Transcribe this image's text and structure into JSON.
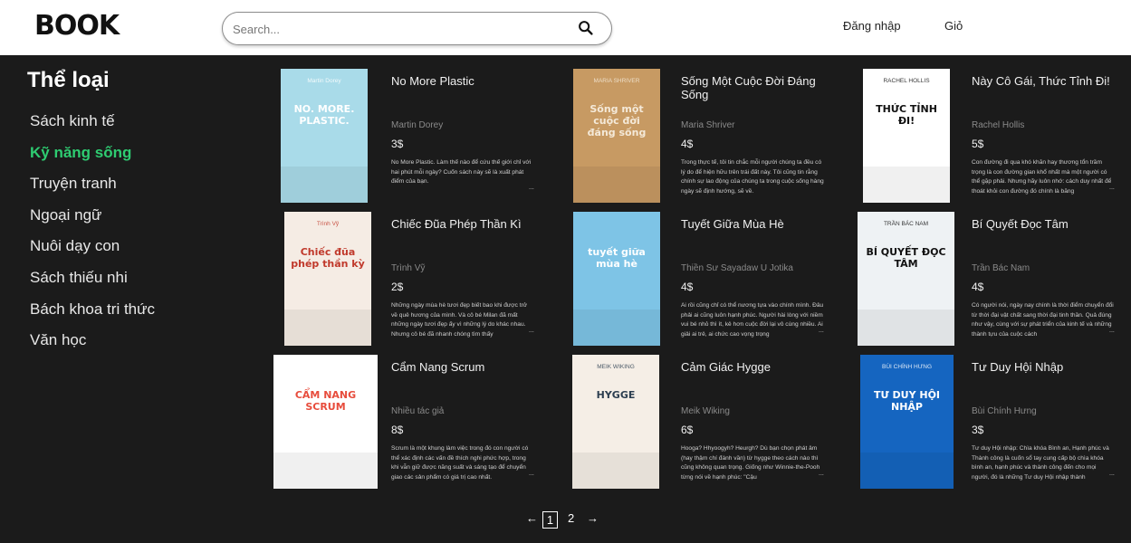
{
  "header": {
    "logo_text": "BOOK",
    "search_placeholder": "Search...",
    "login_label": "Đăng nhập",
    "cart_label": "Giỏ"
  },
  "sidebar": {
    "title": "Thể loại",
    "items": [
      {
        "label": "Sách kinh tế",
        "active": false
      },
      {
        "label": "Kỹ năng sống",
        "active": true
      },
      {
        "label": "Truyện tranh",
        "active": false
      },
      {
        "label": "Ngoại ngữ",
        "active": false
      },
      {
        "label": "Nuôi dạy con",
        "active": false
      },
      {
        "label": "Sách thiếu nhi",
        "active": false
      },
      {
        "label": "Bách khoa tri thức",
        "active": false
      },
      {
        "label": "Văn học",
        "active": false
      }
    ]
  },
  "books": [
    {
      "title": "No More Plastic",
      "author": "Martin Dorey",
      "price": "3$",
      "desc": "No More Plastic. Làm thế nào để cứu thế giới chỉ với hai phút mỗi ngày? Cuốn sách này sẽ là xuất phát điểm của bạn.",
      "more": "...",
      "cover_text": "NO. MORE. PLASTIC.",
      "cover_sub": "Martin Dorey",
      "cover_bg": "#a9dbe9",
      "cover_fg": "#ffffff"
    },
    {
      "title": "Sống Một Cuộc Đời Đáng Sống",
      "author": "Maria Shriver",
      "price": "4$",
      "desc": "Trong thực tế, tôi tin chắc mỗi người chúng ta đều có lý do để hiện hữu trên trái đất này. Tôi cũng tin rằng chính sự lao động của chúng ta trong cuộc sống hàng ngày sẽ định hướng, sẽ về.",
      "more": "",
      "cover_text": "Sống một cuộc đời đáng sống",
      "cover_sub": "MARIA SHRIVER",
      "cover_bg": "#c79a63",
      "cover_fg": "#f4e9d8"
    },
    {
      "title": "Này Cô Gái, Thức Tỉnh Đi!",
      "author": "Rachel Hollis",
      "price": "5$",
      "desc": "Con đường đi qua khó khăn hay thương tổn trầm trọng là con đường gian khổ nhất mà một người có thể gặp phải. Nhưng hãy luôn nhớ: cách duy nhất để thoát khỏi con đường đó chính là băng",
      "more": "...",
      "cover_text": "THỨC TỈNH ĐI!",
      "cover_sub": "RACHEL HOLLIS",
      "cover_bg": "#ffffff",
      "cover_fg": "#111111"
    },
    {
      "title": "Chiếc Đũa Phép Thần Kì",
      "author": "Trình Vỹ",
      "price": "2$",
      "desc": "Những ngày mùa hè tươi đẹp biết bao khi được trở về quê hương của mình. Và cô bé Milan đã mất những ngày tươi đẹp ấy vì những lý do khác nhau. Nhưng cô bé đã nhanh chóng tìm thấy",
      "more": "...",
      "cover_text": "Chiếc đũa phép thần kỳ",
      "cover_sub": "Trình Vỹ",
      "cover_bg": "#f5ece4",
      "cover_fg": "#c0392b"
    },
    {
      "title": "Tuyết Giữa Mùa Hè",
      "author": "Thiền Sư Sayadaw U Jotika",
      "price": "4$",
      "desc": "Ai rồi cũng chỉ có thể nương tựa vào chính mình. Đâu phải ai cũng luôn hạnh phúc. Người hài lòng với niềm vui bé nhỏ thì ít, kẻ hơn cuộc đời lại vô cùng nhiều. Ai giải ai trẻ, ai chức cao vọng trọng",
      "more": "...",
      "cover_text": "tuyết giữa mùa hè",
      "cover_sub": "",
      "cover_bg": "#7ec4e6",
      "cover_fg": "#ffffff"
    },
    {
      "title": "Bí Quyết Đọc Tâm",
      "author": "Trần Bác Nam",
      "price": "4$",
      "desc": "Có người nói, ngày nay chính là thời điểm chuyển đổi từ thời đại vật chất sang thời đại tinh thần. Quả đúng như vậy, cùng với sự phát triển của kinh tế và những thành tựu của cuộc cách",
      "more": "...",
      "cover_text": "BÍ QUYẾT ĐỌC TÂM",
      "cover_sub": "TRẦN BÁC NAM",
      "cover_bg": "#eef2f4",
      "cover_fg": "#111111"
    },
    {
      "title": "Cẩm Nang Scrum",
      "author": "Nhiều tác giả",
      "price": "8$",
      "desc": "Scrum là một khung làm việc trong đó con người có thể xác định các vấn đề thích nghi phức hợp, trong khi vẫn giữ được năng suất và sáng tạo để chuyển giao các sản phẩm có giá trị cao nhất.",
      "more": "...",
      "cover_text": "CẨM NANG SCRUM",
      "cover_sub": "",
      "cover_bg": "#ffffff",
      "cover_fg": "#e74c3c"
    },
    {
      "title": "Cảm Giác Hygge",
      "author": "Meik Wiking",
      "price": "6$",
      "desc": "Hooga? Hhyoogyh? Heurgh? Dù bạn chọn phát âm (hay thậm chí đánh vần) từ hygge theo cách nào thì cũng không quan trọng. Giống như Winnie-the-Pooh từng nói về hạnh phúc: \"Cậu",
      "more": "...",
      "cover_text": "HYGGE",
      "cover_sub": "MEIK WIKING",
      "cover_bg": "#f5eee6",
      "cover_fg": "#2c3e50"
    },
    {
      "title": "Tư Duy Hội Nhập",
      "author": "Bùi Chính Hưng",
      "price": "3$",
      "desc": "Tư duy Hội nhập: Chìa khóa Bình an, Hạnh phúc và Thành công là cuốn sổ tay cung cấp bộ chìa khóa bình an, hạnh phúc và thành công đến cho mọi người, đó là những Tư duy Hội nhập thành",
      "more": "...",
      "cover_text": "TƯ DUY HỘI NHẬP",
      "cover_sub": "BÙI CHÍNH HƯNG",
      "cover_bg": "#1565c0",
      "cover_fg": "#ffffff"
    }
  ],
  "pagination": {
    "prev": "←",
    "pages": [
      "1",
      "2"
    ],
    "current": "1",
    "next": "→"
  }
}
